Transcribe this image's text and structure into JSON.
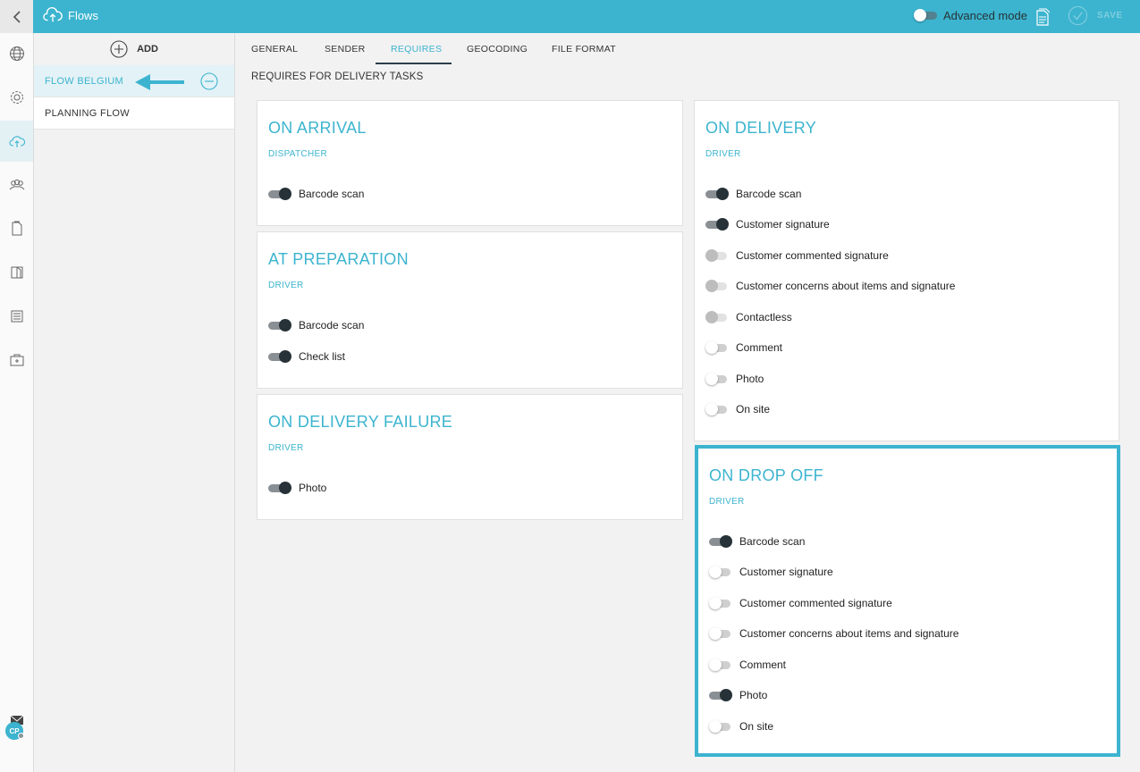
{
  "header": {
    "app_title": "Flows",
    "advanced_mode_label": "Advanced mode",
    "advanced_mode_on": false,
    "save_label": "SAVE"
  },
  "rail": {
    "items": [
      "globe-icon",
      "gear-icon",
      "cloud-upload-icon",
      "team-icon",
      "document-icon",
      "book-icon",
      "list-icon",
      "medkit-icon"
    ],
    "active": "cloud-upload-icon",
    "bottom": [
      "mail-icon"
    ],
    "avatar_initials": "CP"
  },
  "flows": {
    "add_label": "ADD",
    "items": [
      {
        "label": "FLOW BELGIUM",
        "selected": true
      },
      {
        "label": "PLANNING FLOW",
        "selected": false
      }
    ]
  },
  "tabs": [
    {
      "label": "GENERAL",
      "active": false
    },
    {
      "label": "SENDER",
      "active": false
    },
    {
      "label": "REQUIRES",
      "active": true
    },
    {
      "label": "GEOCODING",
      "active": false
    },
    {
      "label": "FILE FORMAT",
      "active": false
    }
  ],
  "main": {
    "section_title": "REQUIRES FOR DELIVERY TASKS",
    "cards": [
      {
        "title": "ON ARRIVAL",
        "subtitle": "DISPATCHER",
        "options": [
          {
            "label": "Barcode scan",
            "state": "on"
          }
        ]
      },
      {
        "title": "AT PREPARATION",
        "subtitle": "DRIVER",
        "options": [
          {
            "label": "Barcode scan",
            "state": "on"
          },
          {
            "label": "Check list",
            "state": "on"
          }
        ]
      },
      {
        "title": "ON DELIVERY FAILURE",
        "subtitle": "DRIVER",
        "options": [
          {
            "label": "Photo",
            "state": "on"
          }
        ]
      },
      {
        "title": "ON DELIVERY",
        "subtitle": "DRIVER",
        "options": [
          {
            "label": "Barcode scan",
            "state": "on"
          },
          {
            "label": "Customer signature",
            "state": "on"
          },
          {
            "label": "Customer commented signature",
            "state": "disabled"
          },
          {
            "label": "Customer concerns about items and signature",
            "state": "disabled"
          },
          {
            "label": "Contactless",
            "state": "disabled"
          },
          {
            "label": "Comment",
            "state": "off"
          },
          {
            "label": "Photo",
            "state": "off"
          },
          {
            "label": "On site",
            "state": "off"
          }
        ]
      },
      {
        "title": "ON DROP OFF",
        "subtitle": "DRIVER",
        "options": [
          {
            "label": "Barcode scan",
            "state": "on"
          },
          {
            "label": "Customer signature",
            "state": "off"
          },
          {
            "label": "Customer commented signature",
            "state": "off"
          },
          {
            "label": "Customer concerns about items and signature",
            "state": "off"
          },
          {
            "label": "Comment",
            "state": "off"
          },
          {
            "label": "Photo",
            "state": "on"
          },
          {
            "label": "On site",
            "state": "off"
          }
        ]
      }
    ]
  },
  "colors": {
    "accent": "#3cb4cf",
    "toggle_on": "#263238",
    "highlight": "#3cb4cf"
  }
}
